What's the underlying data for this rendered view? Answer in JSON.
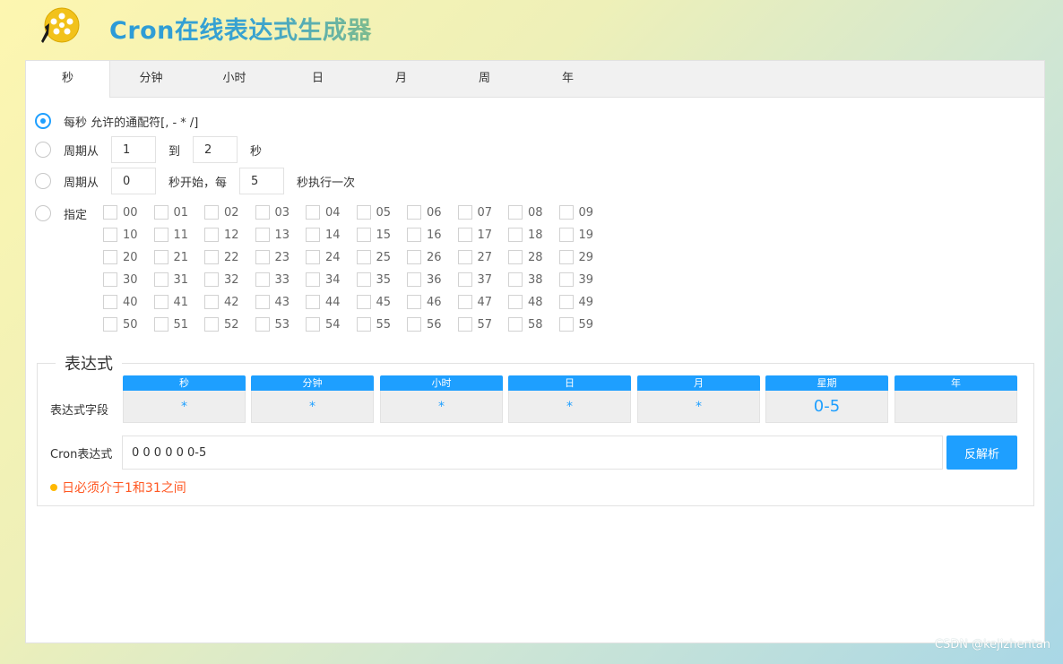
{
  "header": {
    "title": "Cron在线表达式生成器",
    "logo_icon": "film-reel-icon"
  },
  "tabs": [
    "秒",
    "分钟",
    "小时",
    "日",
    "月",
    "周",
    "年"
  ],
  "active_tab": "秒",
  "options": {
    "every": {
      "label": "每秒 允许的通配符[, - * /]"
    },
    "range": {
      "prefix": "周期从",
      "from": "1",
      "mid": "到",
      "to": "2",
      "suffix": "秒"
    },
    "step": {
      "prefix": "周期从",
      "start": "0",
      "mid": "秒开始，每",
      "interval": "5",
      "suffix": "秒执行一次"
    },
    "specify": {
      "label": "指定"
    }
  },
  "seconds": [
    "00",
    "01",
    "02",
    "03",
    "04",
    "05",
    "06",
    "07",
    "08",
    "09",
    "10",
    "11",
    "12",
    "13",
    "14",
    "15",
    "16",
    "17",
    "18",
    "19",
    "20",
    "21",
    "22",
    "23",
    "24",
    "25",
    "26",
    "27",
    "28",
    "29",
    "30",
    "31",
    "32",
    "33",
    "34",
    "35",
    "36",
    "37",
    "38",
    "39",
    "40",
    "41",
    "42",
    "43",
    "44",
    "45",
    "46",
    "47",
    "48",
    "49",
    "50",
    "51",
    "52",
    "53",
    "54",
    "55",
    "56",
    "57",
    "58",
    "59"
  ],
  "expression": {
    "legend": "表达式",
    "field_label": "表达式字段",
    "fields": [
      {
        "name": "秒",
        "value": "*"
      },
      {
        "name": "分钟",
        "value": "*"
      },
      {
        "name": "小时",
        "value": "*"
      },
      {
        "name": "日",
        "value": "*"
      },
      {
        "name": "月",
        "value": "*"
      },
      {
        "name": "星期",
        "value": "0-5"
      },
      {
        "name": "年",
        "value": ""
      }
    ],
    "cron_label": "Cron表达式",
    "cron_value": "0 0 0 0 0 0-5",
    "parse_button": "反解析",
    "error": "日必须介于1和31之间"
  },
  "watermark": "CSDN @kejizhentan",
  "colors": {
    "accent": "#1e9fff",
    "error": "#ff5722",
    "warn_dot": "#ffb800"
  }
}
